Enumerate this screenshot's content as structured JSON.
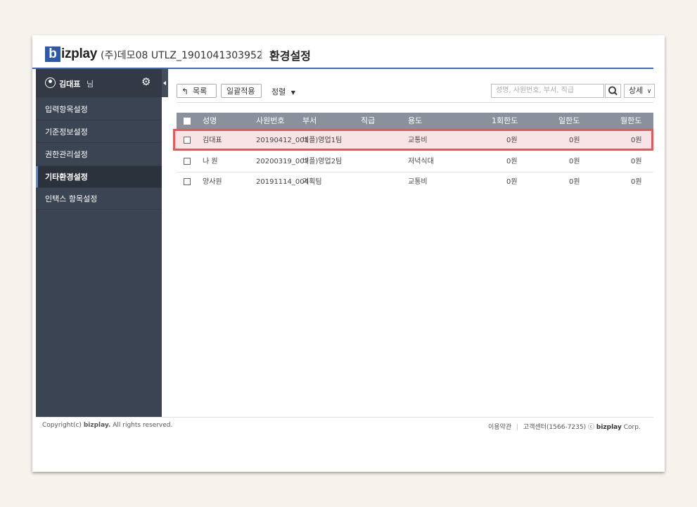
{
  "header": {
    "logo_mark": "b",
    "logo_text": "izplay",
    "company": "(주)데모08 UTLZ_1901041303952",
    "page_title": "환경설정"
  },
  "sidebar": {
    "user_name": "김대표",
    "user_suffix": "님",
    "items": [
      {
        "label": "입력항목설정",
        "active": false
      },
      {
        "label": "기준정보설정",
        "active": false
      },
      {
        "label": "권한관리설정",
        "active": false
      },
      {
        "label": "기타환경설정",
        "active": true
      },
      {
        "label": "인택스 항목설정",
        "active": false
      }
    ]
  },
  "toolbar": {
    "list_label": "목록",
    "bulk_label": "일괄적용",
    "sort_label": "정렬",
    "search_placeholder": "성명, 사원번호, 부서, 직급",
    "detail_label": "상세"
  },
  "table": {
    "headers": [
      "성명",
      "사원번호",
      "부서",
      "직급",
      "용도",
      "1회한도",
      "일한도",
      "월한도"
    ],
    "rows": [
      {
        "name": "김대표",
        "emp_no": "20190412_001",
        "dept": "비플)영업1팀",
        "rank": "",
        "usage": "교통비",
        "once": "0원",
        "daily": "0원",
        "monthly": "0원",
        "highlighted": true
      },
      {
        "name": "나 원",
        "emp_no": "20200319_007",
        "dept": "비플)영업2팀",
        "rank": "",
        "usage": "저녁식대",
        "once": "0원",
        "daily": "0원",
        "monthly": "0원",
        "highlighted": false
      },
      {
        "name": "양사원",
        "emp_no": "20191114_004",
        "dept": "기획팀",
        "rank": "",
        "usage": "교통비",
        "once": "0원",
        "daily": "0원",
        "monthly": "0원",
        "highlighted": false
      }
    ]
  },
  "footer": {
    "copyright_prefix": "Copyright(c) ",
    "copyright_brand": "bizplay.",
    "copyright_suffix": " All rights reserved.",
    "terms": "이용약관",
    "support": "고객센터(1566-7235)",
    "corp_prefix": "ⓒ ",
    "corp_brand": "bizplay",
    "corp_suffix": " Corp."
  },
  "colors": {
    "brand": "#2c5aa8",
    "sidebar_bg": "#3b4452",
    "table_header_bg": "#8a919c",
    "highlight_border": "#e05a5f",
    "highlight_bg": "#f8e4e6"
  }
}
